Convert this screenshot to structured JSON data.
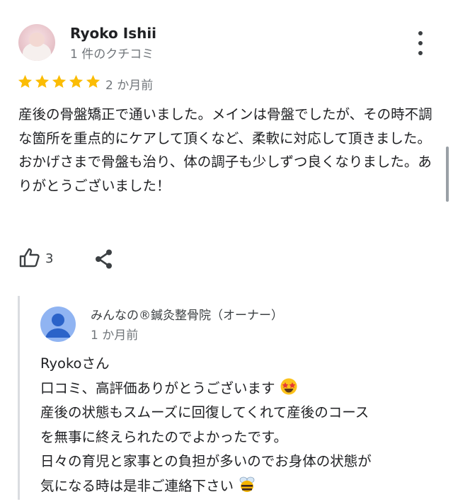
{
  "review": {
    "author_name": "Ryoko Ishii",
    "author_meta": "1 件のクチコミ",
    "rating": 5,
    "rating_max": 5,
    "time": "2 か月前",
    "text": "産後の骨盤矯正で通いました。メインは骨盤でしたが、その時不調な箇所を重点的にケアして頂くなど、柔軟に対応して頂きました。おかげさまで骨盤も治り、体の調子も少しずつ良くなりました。ありがとうございました！",
    "like_count": "3"
  },
  "reply": {
    "owner_name": "みんなの®鍼灸整骨院（オーナー）",
    "time": "1 か月前",
    "lines": [
      "Ryokoさん",
      "口コミ、高評価ありがとうございます",
      "産後の状態もスムーズに回復してくれて産後のコース",
      "を無事に終えられたのでよかったです。",
      "日々の育児と家事との負担が多いのでお身体の状態が",
      "気になる時は是非ご連絡下さい"
    ]
  },
  "colors": {
    "star": "#fbbc04",
    "secondary_text": "#70757a",
    "owner_avatar": "#90b4f2"
  },
  "icons": [
    "more-vert-icon",
    "star-icon",
    "thumb-up-icon",
    "share-icon",
    "person-icon",
    "star-struck-emoji",
    "bee-emoji"
  ]
}
